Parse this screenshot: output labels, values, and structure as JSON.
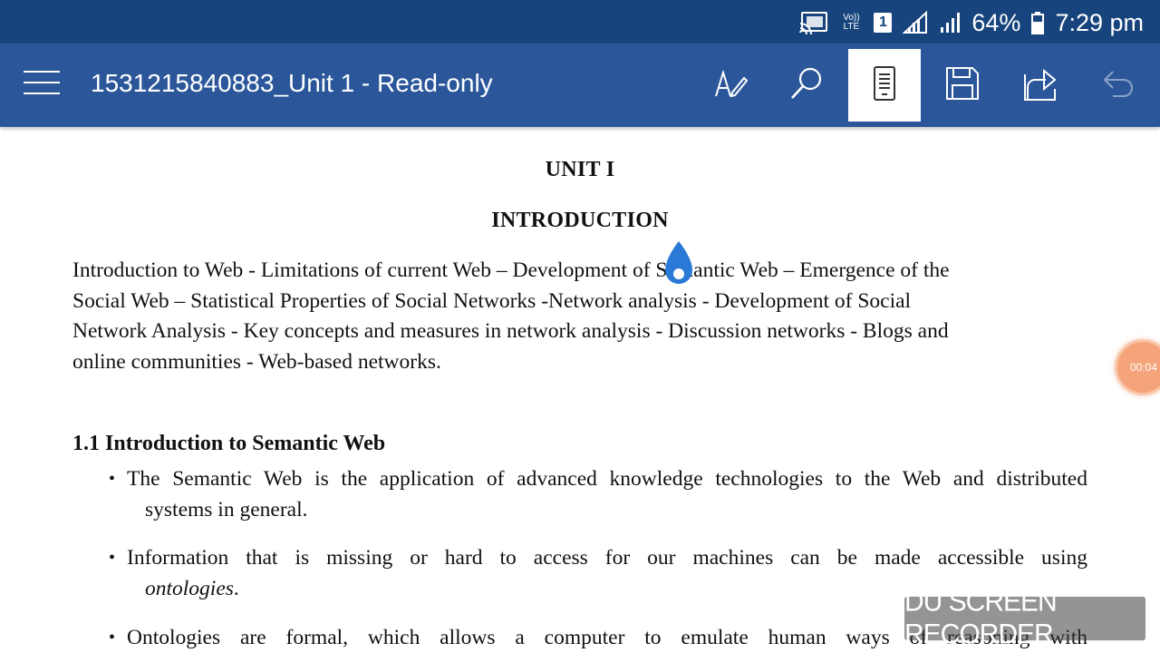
{
  "status_bar": {
    "volte_label": "Vo)) LTE",
    "sim_slot": "1",
    "battery_percent": "64%",
    "time": "7:29 pm",
    "icons": [
      "cast-icon",
      "volte-icon",
      "sim-icon",
      "signal-icon",
      "signal-icon",
      "battery-icon"
    ]
  },
  "app_bar": {
    "title": "1531215840883_Unit 1 - Read-only",
    "toolbar": [
      "draw-pen-icon",
      "search-icon",
      "mobile-view-icon",
      "save-icon",
      "share-icon",
      "undo-icon"
    ],
    "active_tool": "mobile-view-icon"
  },
  "document": {
    "unit_heading": "UNIT I",
    "section_title": "INTRODUCTION",
    "intro_lines": [
      "Introduction to Web - Limitations of current Web – Development of Semantic Web – Emergence of the",
      "Social Web – Statistical Properties of Social Networks -Network analysis - Development of Social",
      "Network Analysis - Key concepts and measures in network analysis - Discussion networks - Blogs and",
      "online communities - Web-based networks."
    ],
    "subsection_heading": "1.1 Introduction to Semantic Web",
    "bullets": [
      {
        "line1": "The Semantic Web is the application of advanced knowledge technologies to the Web and distributed",
        "line2": "systems in general.",
        "line2_italic": ""
      },
      {
        "line1": "Information that is missing or hard to access for our machines can be made accessible using",
        "line2": "",
        "line2_italic": "ontologies",
        "line2_suffix": "."
      },
      {
        "line1": "Ontologies are formal, which allows a computer to emulate human ways of reasoning with"
      }
    ]
  },
  "overlay": {
    "recorder_timer": "00:04",
    "watermark": "DU SCREEN RECORDER"
  },
  "colors": {
    "status_bar": "#17447d",
    "app_bar": "#2b579a",
    "cursor_handle": "#2b79d6",
    "recorder_bubble": "#f4a37a"
  }
}
